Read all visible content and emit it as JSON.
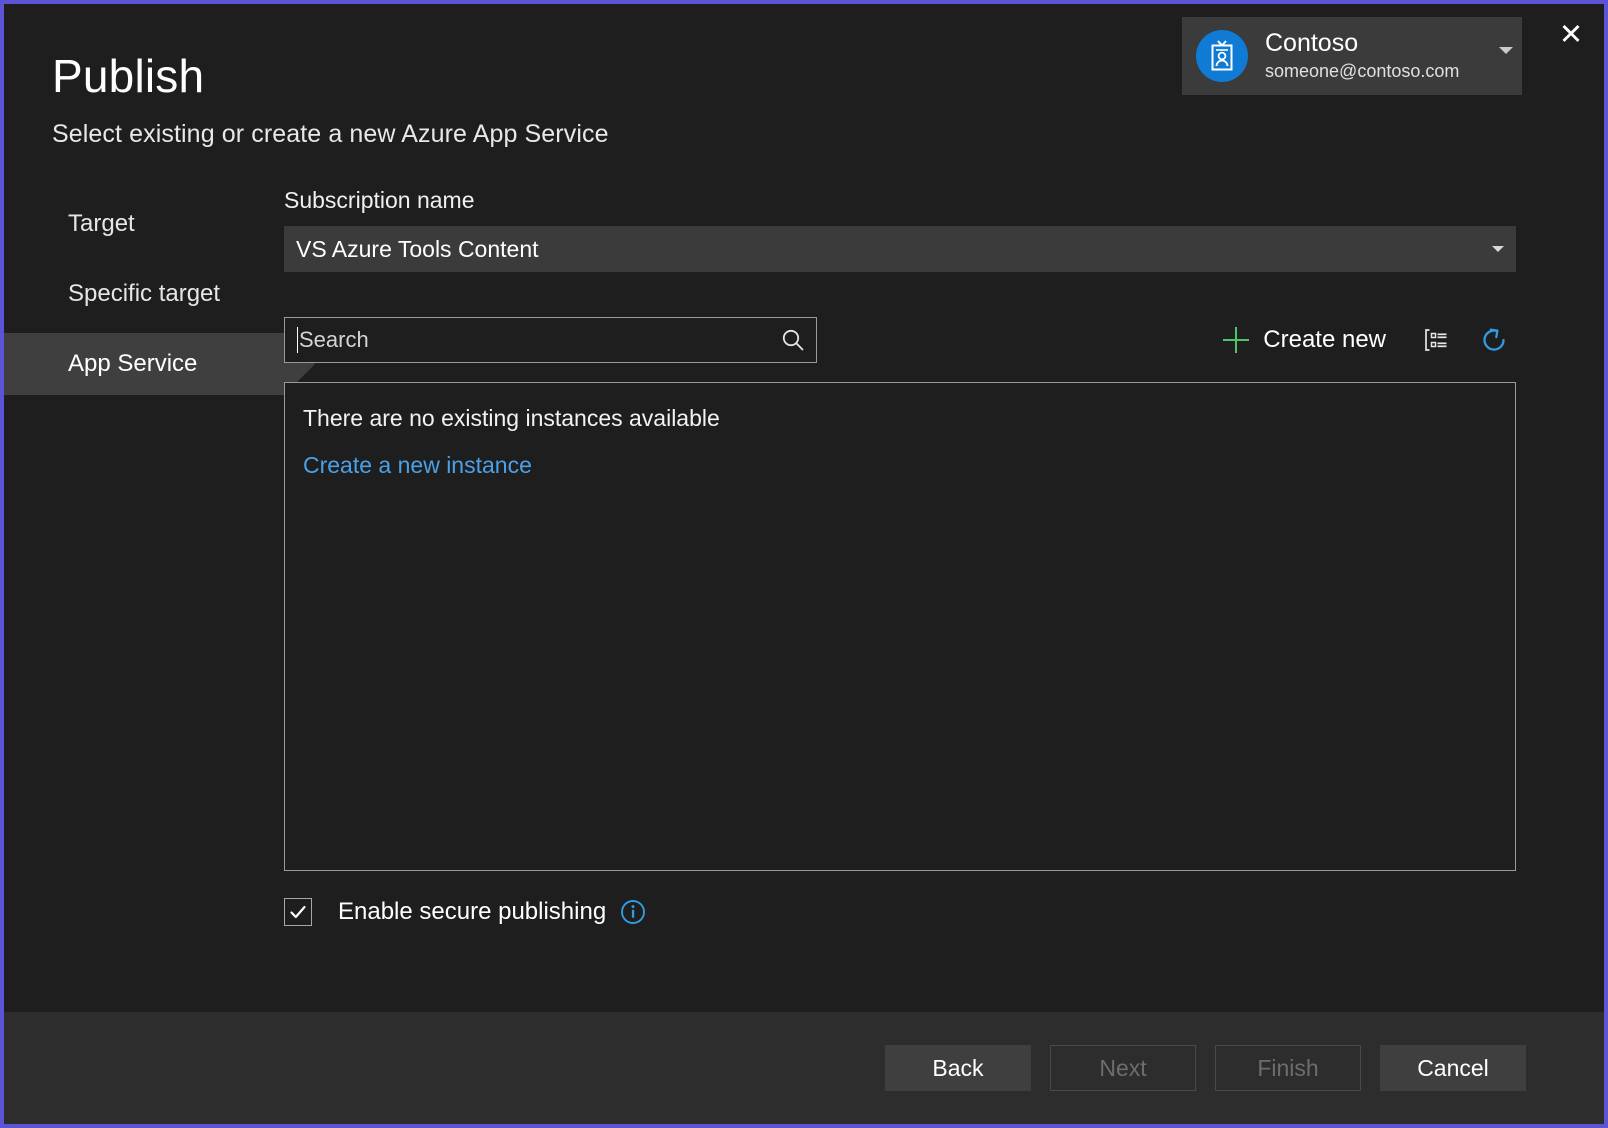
{
  "window": {
    "close_label": "✕",
    "accent_border_color": "#5b55d6",
    "background_color": "#1e1e1e"
  },
  "header": {
    "title": "Publish",
    "subtitle": "Select existing or create a new Azure App Service"
  },
  "account": {
    "name": "Contoso",
    "email": "someone@contoso.com",
    "avatar_icon": "badge-id-icon",
    "avatar_color": "#0f7bd4",
    "caret_icon": "chevron-down-icon"
  },
  "nav": {
    "items": [
      {
        "label": "Target",
        "selected": false
      },
      {
        "label": "Specific target",
        "selected": false
      },
      {
        "label": "App Service",
        "selected": true
      }
    ]
  },
  "subscription": {
    "label": "Subscription name",
    "value": "VS Azure Tools Content",
    "caret_icon": "chevron-down-icon"
  },
  "toolbar": {
    "search_placeholder": "Search",
    "search_value": "",
    "search_icon": "search-icon",
    "create_new_label": "Create new",
    "create_new_icon": "plus-icon",
    "create_new_icon_color": "#49c56a",
    "group_icon": "group-by-icon",
    "refresh_icon": "refresh-icon",
    "refresh_icon_color": "#2f9de0"
  },
  "instances": {
    "empty_message": "There are no existing instances available",
    "create_link": "Create a new instance",
    "link_color": "#4ba0e8"
  },
  "secure_publishing": {
    "label": "Enable secure publishing",
    "checked": true,
    "check_glyph": "✔",
    "info_icon": "info-icon",
    "info_icon_color": "#2f9de0"
  },
  "footer": {
    "buttons": [
      {
        "label": "Back",
        "enabled": true
      },
      {
        "label": "Next",
        "enabled": false
      },
      {
        "label": "Finish",
        "enabled": false
      },
      {
        "label": "Cancel",
        "enabled": true
      }
    ]
  }
}
